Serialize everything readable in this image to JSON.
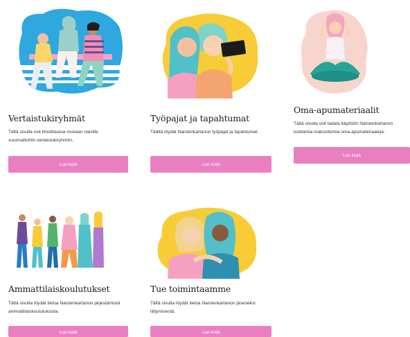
{
  "button_color": "#e97fc0",
  "cards": [
    {
      "title": "Vertaistukiryhmät",
      "description": "Tältä sivulla voit ilmoittautua mukaan naisille suunnattuihin vertaistukiryhmiin.",
      "button": "Lue lisää",
      "illustration": "peer-support-group-illustration"
    },
    {
      "title": "Työpajat ja tapahtumat",
      "description": "Täältä löydät Naistenkartanon työpajat ja tapahtumat.",
      "button": "Lue lisää",
      "illustration": "workshop-selfie-illustration"
    },
    {
      "title": "Oma-apumateriaalit",
      "description": "Tältä sivulla voit ladata käyttöön Naistenkartanon tuottamia maksuttomia oma-apumateriaaleja.",
      "button": "Lue lisää",
      "illustration": "meditating-woman-illustration"
    },
    {
      "title": "Ammattilaiskoulutukset",
      "description": "Tältä sivulta löydät tietoa Naistenkartanon järjestämistä ammattilaiskoulutuksista.",
      "button": "Lue lisää",
      "illustration": "group-of-women-illustration"
    },
    {
      "title": "Tue toimintaamme",
      "description": "Tältä sivulta löydät tietoa Naistenkartanon jäseneksi liittymisestä.",
      "button": "Lue lisää",
      "illustration": "two-women-hugging-illustration"
    }
  ]
}
